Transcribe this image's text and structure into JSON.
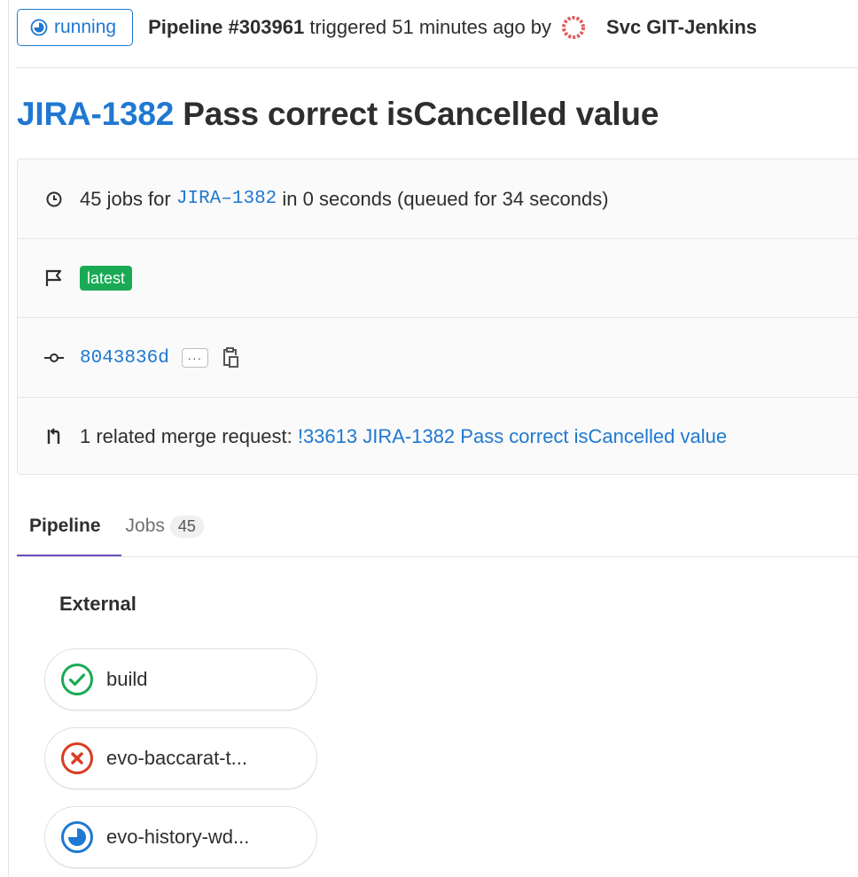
{
  "header": {
    "status_label": "running",
    "pipeline_label": "Pipeline #303961",
    "triggered_text": "triggered 51 minutes ago by",
    "user_name": "Svc GIT-Jenkins"
  },
  "title": {
    "issue": "JIRA-1382",
    "text": "Pass correct isCancelled value"
  },
  "info": {
    "jobs_prefix": "45 jobs for",
    "branch": "JIRA–1382",
    "jobs_suffix": "in 0 seconds (queued for 34 seconds)",
    "latest_badge": "latest",
    "commit_sha": "8043836d",
    "ellipsis": "···",
    "mr_prefix": "1 related merge request:",
    "mr_link": "!33613 JIRA-1382 Pass correct isCancelled value"
  },
  "tabs": {
    "pipeline_label": "Pipeline",
    "jobs_label": "Jobs",
    "jobs_count": "45"
  },
  "stage": {
    "title": "External",
    "jobs": [
      {
        "name": "build",
        "status": "success"
      },
      {
        "name": "evo-baccarat-t...",
        "status": "failed"
      },
      {
        "name": "evo-history-wd...",
        "status": "running"
      }
    ]
  },
  "colors": {
    "link": "#1f78d1",
    "success": "#1aaa55",
    "failed": "#db3b21",
    "running": "#1f78d1",
    "tab_active": "#6b4fbb"
  }
}
